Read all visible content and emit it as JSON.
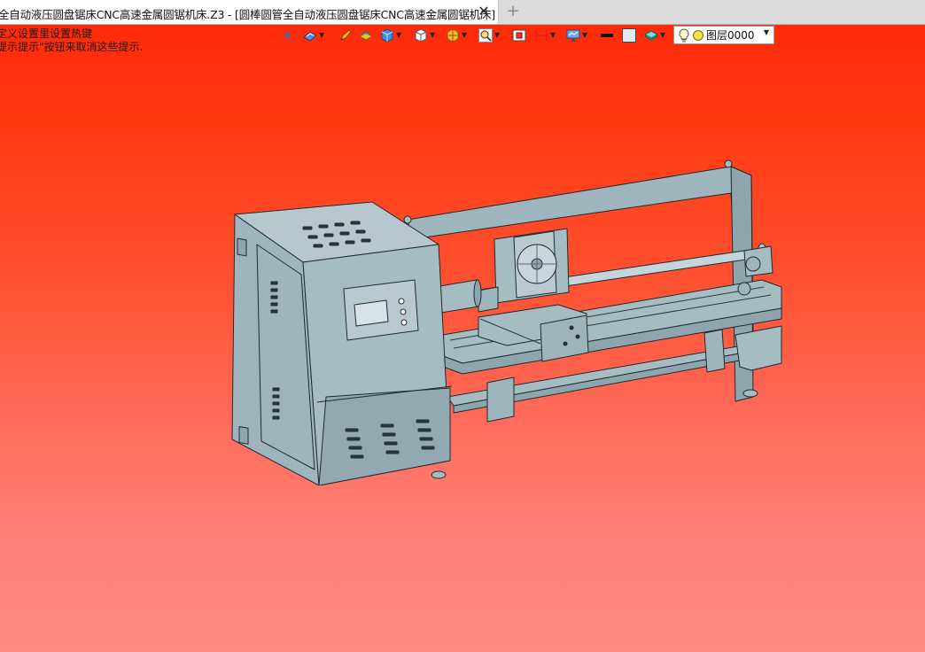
{
  "tab": {
    "title": "全自动液压圆盘锯床CNC高速金属圆锯机床.Z3 - [圆棒圆管全自动液压圆盘锯床CNC高速金属圆锯机床]",
    "close_icon": "close-icon",
    "new_tab_icon": "plus-icon"
  },
  "hint": {
    "line1": "定义设置里设置热键",
    "line2": "提示提示\"按钮来取消这些提示."
  },
  "toolbar": {
    "tools": [
      {
        "name": "exit-icon"
      },
      {
        "name": "view-orient-icon",
        "dropdown": true
      },
      {
        "name": "pen-icon"
      },
      {
        "name": "shaded-box-icon"
      },
      {
        "name": "cube-view-icon",
        "dropdown": true
      },
      {
        "name": "cube-outline-icon",
        "dropdown": true
      },
      {
        "name": "section-icon",
        "dropdown": true
      },
      {
        "name": "zoom-icon",
        "dropdown": true
      },
      {
        "name": "fit-icon"
      },
      {
        "name": "dimension-icon",
        "dropdown": true
      },
      {
        "name": "display-icon",
        "dropdown": true
      },
      {
        "name": "line-color-icon"
      },
      {
        "name": "fill-color-icon"
      },
      {
        "name": "layer-stack-icon",
        "dropdown": true
      }
    ],
    "layer": {
      "label": "图层0000",
      "bulb_icon": "lightbulb-icon",
      "status_icon": "layer-on-icon"
    }
  },
  "colors": {
    "viewport_top": "#ff2a0a",
    "viewport_bottom": "#ff8b85",
    "model_fill": "#a6bcc3",
    "model_dark": "#8ea5ad",
    "model_stroke": "#1f2a2e"
  }
}
